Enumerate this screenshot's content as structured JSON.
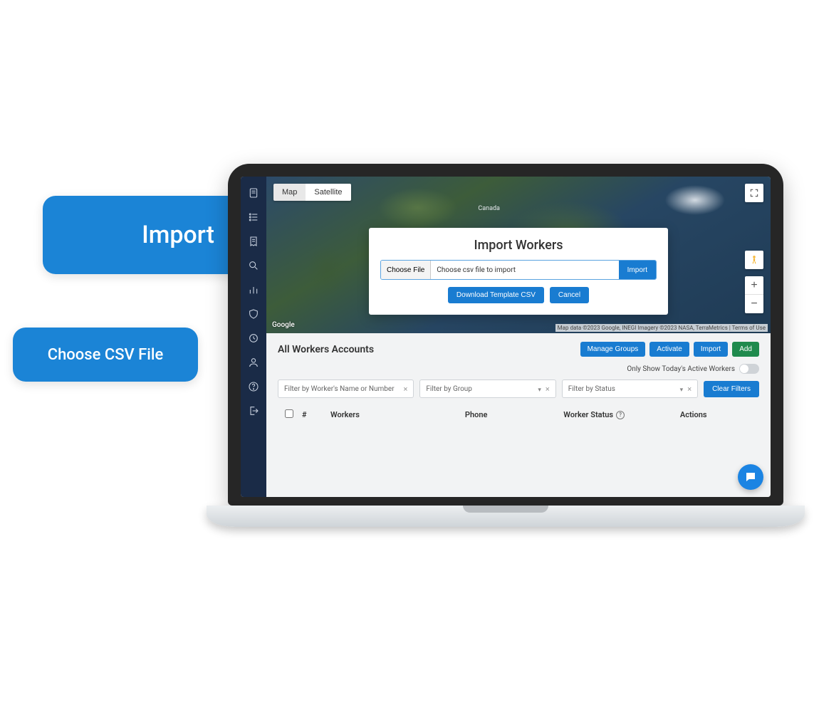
{
  "callouts": {
    "import_label": "Import",
    "choose_label": "Choose CSV File"
  },
  "map": {
    "type_map": "Map",
    "type_satellite": "Satellite",
    "google_label": "Google",
    "attribution": "Map data ©2023 Google, INEGI Imagery ©2023 NASA, TerraMetrics | Terms of Use",
    "location_label": "Canada",
    "zoom_in": "+",
    "zoom_out": "−"
  },
  "modal": {
    "title": "Import Workers",
    "choose_file": "Choose File",
    "placeholder": "Choose csv file to import",
    "import_btn": "Import",
    "download_btn": "Download Template CSV",
    "cancel_btn": "Cancel"
  },
  "section": {
    "title": "All Workers Accounts",
    "buttons": {
      "manage_groups": "Manage Groups",
      "activate": "Activate",
      "import": "Import",
      "add": "Add"
    },
    "toggle_label": "Only Show Today's Active Workers",
    "filters": {
      "name_placeholder": "Filter by Worker's Name or Number",
      "group_placeholder": "Filter by Group",
      "status_placeholder": "Filter by Status",
      "clear": "Clear Filters"
    },
    "columns": {
      "num": "#",
      "workers": "Workers",
      "phone": "Phone",
      "status": "Worker Status",
      "actions": "Actions"
    }
  },
  "sidebar": {
    "items": [
      "documents",
      "checklist",
      "receipt",
      "search",
      "analytics",
      "shield",
      "clock",
      "worker",
      "help",
      "logout"
    ]
  }
}
